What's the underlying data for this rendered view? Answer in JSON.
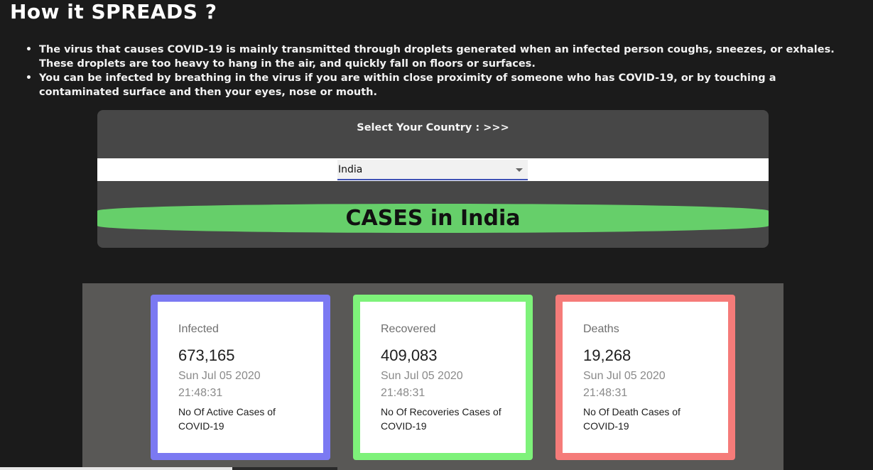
{
  "title": "How it SPREADS ?",
  "bullets": [
    "The virus that causes COVID-19 is mainly transmitted through droplets generated when an infected person coughs, sneezes, or exhales. These droplets are too heavy to hang in the air, and quickly fall on floors or surfaces.",
    "You can be infected by breathing in the virus if you are within close proximity of someone who has COVID-19, or by touching a contaminated surface and then your eyes, nose or mouth."
  ],
  "selector": {
    "label": "Select Your Country : >>>",
    "selected_country": "India",
    "dropdown_icon": "chevron-down-icon"
  },
  "banner": "CASES in India",
  "cards": [
    {
      "label": "Infected",
      "count": "673,165",
      "date": "Sun Jul 05 2020",
      "time": "21:48:31",
      "description": "No Of Active Cases of COVID-19",
      "color": "#7b79f2"
    },
    {
      "label": "Recovered",
      "count": "409,083",
      "date": "Sun Jul 05 2020",
      "time": "21:48:31",
      "description": "No Of Recoveries Cases of COVID-19",
      "color": "#7ef27a"
    },
    {
      "label": "Deaths",
      "count": "19,268",
      "date": "Sun Jul 05 2020",
      "time": "21:48:31",
      "description": "No Of Death Cases of COVID-19",
      "color": "#f57b79"
    }
  ],
  "colors": {
    "background": "#1b1b1b",
    "panel": "#474747",
    "banner": "#66cf6a",
    "stats_panel": "#595856",
    "select_underline": "#3f51b5"
  }
}
